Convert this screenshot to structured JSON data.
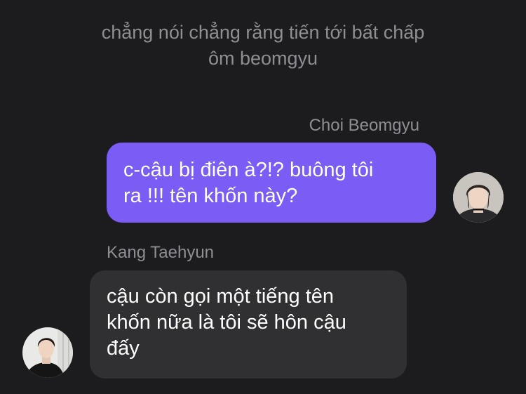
{
  "system_message": {
    "line1": "chẳng nói chẳng rằng tiến tới bất chấp",
    "line2": "ôm beomgyu"
  },
  "messages": [
    {
      "sender": "Choi Beomgyu",
      "direction": "outgoing",
      "lines": [
        "c-cậu bị điên à?!? buông tôi",
        "ra !!! tên khốn này?"
      ],
      "bubble_color": "#7b5cf5",
      "avatar_icon": "beomgyu-avatar"
    },
    {
      "sender": "Kang Taehyun",
      "direction": "incoming",
      "lines": [
        "cậu còn gọi một tiếng tên",
        "khốn nữa là tôi sẽ hôn cậu",
        "đấy"
      ],
      "bubble_color": "#303033",
      "avatar_icon": "taehyun-avatar"
    }
  ],
  "colors": {
    "background": "#1c1c1e",
    "muted_text": "#8e8e93",
    "text": "#ffffff"
  }
}
